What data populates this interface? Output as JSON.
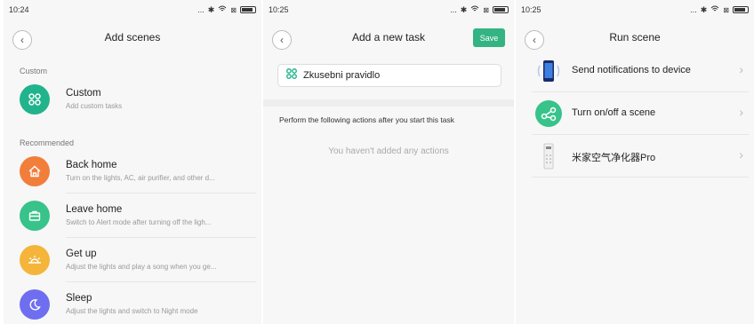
{
  "screens": {
    "add_scenes": {
      "time": "10:24",
      "title": "Add scenes",
      "section_custom": "Custom",
      "custom": {
        "title": "Custom",
        "subtitle": "Add custom tasks",
        "color": "#21b48c",
        "icon": "scene-grid-icon"
      },
      "section_recommended": "Recommended",
      "recommended": [
        {
          "title": "Back home",
          "subtitle": "Turn on the lights, AC, air purifier, and other d...",
          "color": "#f27e3c",
          "icon": "home-icon"
        },
        {
          "title": "Leave home",
          "subtitle": "Switch to Alert mode after turning off the ligh...",
          "color": "#37c38a",
          "icon": "briefcase-icon"
        },
        {
          "title": "Get up",
          "subtitle": "Adjust the lights and play a song when you ge...",
          "color": "#f5b43a",
          "icon": "sunrise-icon"
        },
        {
          "title": "Sleep",
          "subtitle": "Adjust the lights and switch to Night mode",
          "color": "#6f6ef0",
          "icon": "moon-icon"
        }
      ]
    },
    "add_task": {
      "time": "10:25",
      "title": "Add a new task",
      "save_label": "Save",
      "task_name": "Zkusebni pravidlo",
      "actions_hint": "Perform the following actions after you start this task",
      "no_actions": "You haven't added any actions"
    },
    "run_scene": {
      "time": "10:25",
      "title": "Run scene",
      "rows": [
        {
          "label": "Send notifications to device",
          "icon": "phone-notify-icon"
        },
        {
          "label": "Turn on/off a scene",
          "icon": "scene-share-icon"
        },
        {
          "label": "米家空气净化器Pro",
          "icon": "air-purifier-icon"
        }
      ]
    }
  },
  "status": {
    "signal": "...",
    "accent": "#34b383"
  }
}
